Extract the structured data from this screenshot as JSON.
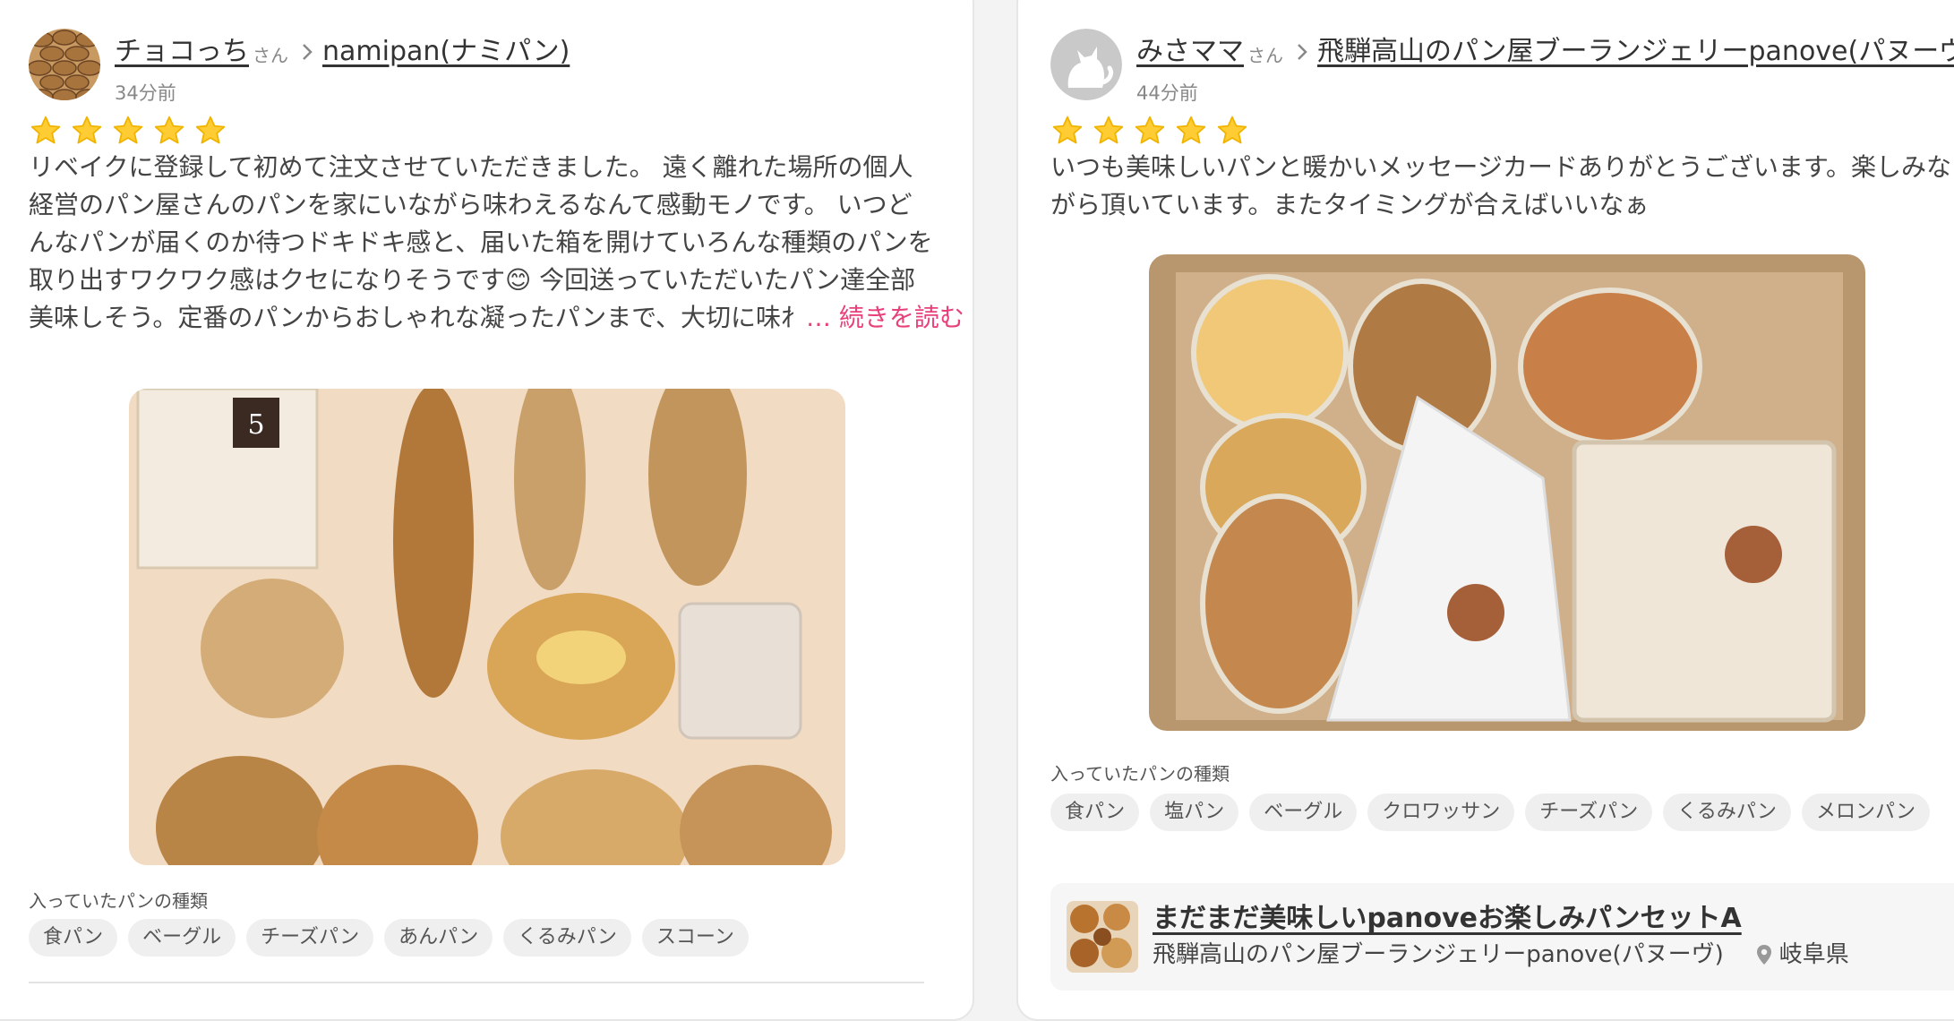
{
  "colors": {
    "accent": "#e8407a",
    "star": "#ffcc33"
  },
  "reviews": [
    {
      "user": "チョコっち",
      "honorific": "さん",
      "shop": "namipan(ナミパン)",
      "time": "34分前",
      "rating": 5,
      "body": "リベイクに登録して初めて注文させていただきました。 遠く離れた場所の個人経営のパン屋さんのパンを家にいながら味わえるなんて感動モノです。 いつどんなパンが届くのか待つドキドキ感と、届いた箱を開けていろんな種類のパンを取り出すワクワク感はクセになりそうです😊 今回送っていただいたパン達全部美味しそう。定番のパンからおしゃれな凝ったパンまで、大切に味わ・",
      "read_more": "… 続きを読む",
      "kinds_label": "入っていたパンの種類",
      "tags": [
        "食パン",
        "ベーグル",
        "チーズパン",
        "あんパン",
        "くるみパン",
        "スコーン"
      ],
      "avatar_icon": "cookie-avatar",
      "photo_icon": "bread-assortment-photo"
    },
    {
      "user": "みさママ",
      "honorific": "さん",
      "shop": "飛騨高山のパン屋ブーランジェリーpanove(パヌーヴ)",
      "time": "44分前",
      "rating": 5,
      "body": "いつも美味しいパンと暖かいメッセージカードありがとうございます。楽しみながら頂いています。またタイミングが合えばいいなぁ",
      "kinds_label": "入っていたパンの種類",
      "tags": [
        "食パン",
        "塩パン",
        "ベーグル",
        "クロワッサン",
        "チーズパン",
        "くるみパン",
        "メロンパン"
      ],
      "avatar_icon": "default-cat-avatar",
      "photo_icon": "bread-box-photo",
      "product": {
        "title": "まだまだ美味しいpanoveお楽しみパンセットA",
        "shop": "飛騨高山のパン屋ブーランジェリーpanove(パヌーヴ)",
        "location": "岐阜県",
        "location_icon": "location-pin-icon"
      }
    }
  ]
}
